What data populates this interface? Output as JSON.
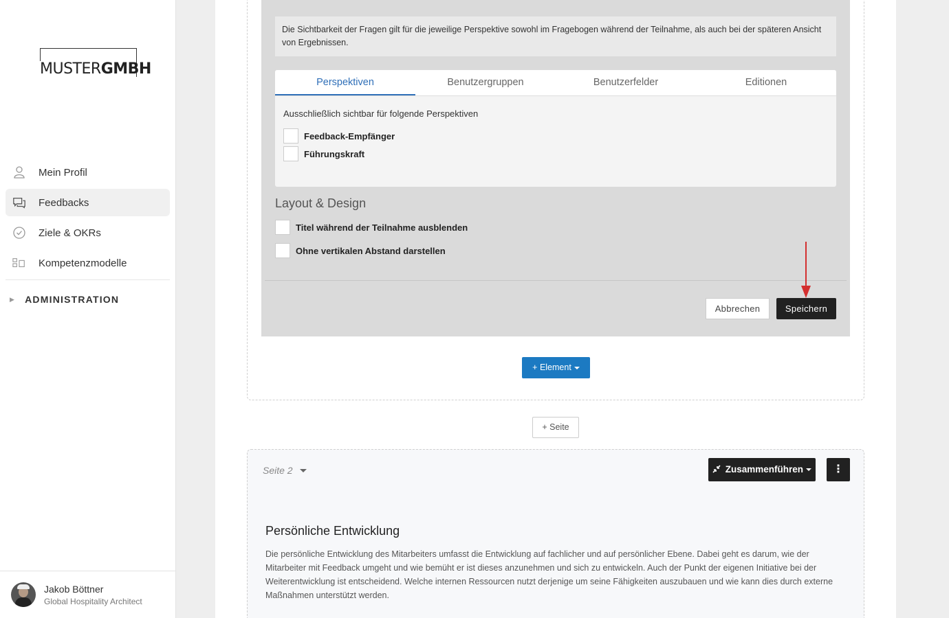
{
  "sidebar": {
    "logo": {
      "part1": "MUSTER",
      "part2": "GMBH"
    },
    "items": [
      {
        "label": "Mein Profil",
        "icon": "user-icon"
      },
      {
        "label": "Feedbacks",
        "icon": "chat-bubbles-icon"
      },
      {
        "label": "Ziele & OKRs",
        "icon": "check-circle-icon"
      },
      {
        "label": "Kompetenzmodelle",
        "icon": "model-icon"
      }
    ],
    "admin_label": "ADMINISTRATION",
    "user": {
      "name": "Jakob Böttner",
      "role": "Global Hospitality Architect"
    }
  },
  "editor": {
    "info_text": "Die Sichtbarkeit der Fragen gilt für die jeweilige Perspektive sowohl im Fragebogen während der Teilnahme, als auch bei der späteren Ansicht von Ergebnissen.",
    "tabs": [
      "Perspektiven",
      "Benutzergruppen",
      "Benutzerfelder",
      "Editionen"
    ],
    "perspectives_label": "Ausschließlich sichtbar für folgende Perspektiven",
    "perspectives": [
      "Feedback-Empfänger",
      "Führungskraft"
    ],
    "layout_title": "Layout & Design",
    "layout_options": [
      "Titel während der Teilnahme ausblenden",
      "Ohne vertikalen Abstand darstellen"
    ],
    "cancel_label": "Abbrechen",
    "save_label": "Speichern"
  },
  "add_element_label": "+ Element",
  "add_page_label": "+ Seite",
  "page2": {
    "label": "Seite 2",
    "merge_label": "Zusammenführen",
    "section_title": "Persönliche Entwicklung",
    "section_text": "Die persönliche Entwicklung des Mitarbeiters umfasst die Entwicklung auf fachlicher und auf persönlicher Ebene. Dabei geht es darum, wie der Mitarbeiter mit Feedback umgeht und wie bemüht er ist dieses anzunehmen und sich zu entwickeln. Auch der Punkt der eigenen Initiative bei der Weiterentwicklung ist entscheidend. Welche internen Ressourcen nutzt derjenige um seine Fähigkeiten auszubauen und wie kann dies durch externe Maßnahmen unterstützt werden."
  },
  "colors": {
    "accent_blue": "#1c7ac2",
    "tab_active": "#2f6fb8",
    "dark_button": "#212121",
    "arrow": "#d32f2f"
  }
}
